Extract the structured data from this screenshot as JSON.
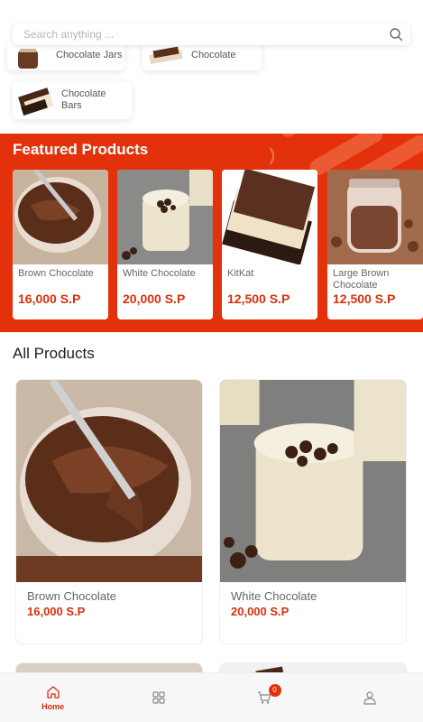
{
  "search": {
    "placeholder": "Search anything ..."
  },
  "categories": [
    {
      "label": "Chocolate Jars",
      "icon": "chocolate-jar-image"
    },
    {
      "label": "Chocolate",
      "icon": "chocolate-bar-image"
    },
    {
      "label": "Chocolate Bars",
      "icon": "chocolate-bars-image"
    }
  ],
  "featured": {
    "title": "Featured Products",
    "items": [
      {
        "name": "Brown Chocolate",
        "price": "16,000 S.P"
      },
      {
        "name": "White Chocolate",
        "price": "20,000 S.P"
      },
      {
        "name": "KitKat",
        "price": "12,500 S.P"
      },
      {
        "name": "Large Brown Chocolate",
        "price": "12,500 S.P"
      }
    ]
  },
  "all_products": {
    "title": "All Products",
    "items": [
      {
        "name": "Brown Chocolate",
        "price": "16,000 S.P"
      },
      {
        "name": "White Chocolate",
        "price": "20,000 S.P"
      }
    ]
  },
  "bottom_nav": {
    "items": [
      {
        "label": "Home",
        "icon": "home-icon",
        "active": true
      },
      {
        "label": "",
        "icon": "grid-icon"
      },
      {
        "label": "",
        "icon": "cart-icon"
      },
      {
        "label": "",
        "icon": "user-icon"
      }
    ],
    "cart_count": "0"
  },
  "colors": {
    "accent": "#e3310b",
    "price": "#d8300b"
  }
}
